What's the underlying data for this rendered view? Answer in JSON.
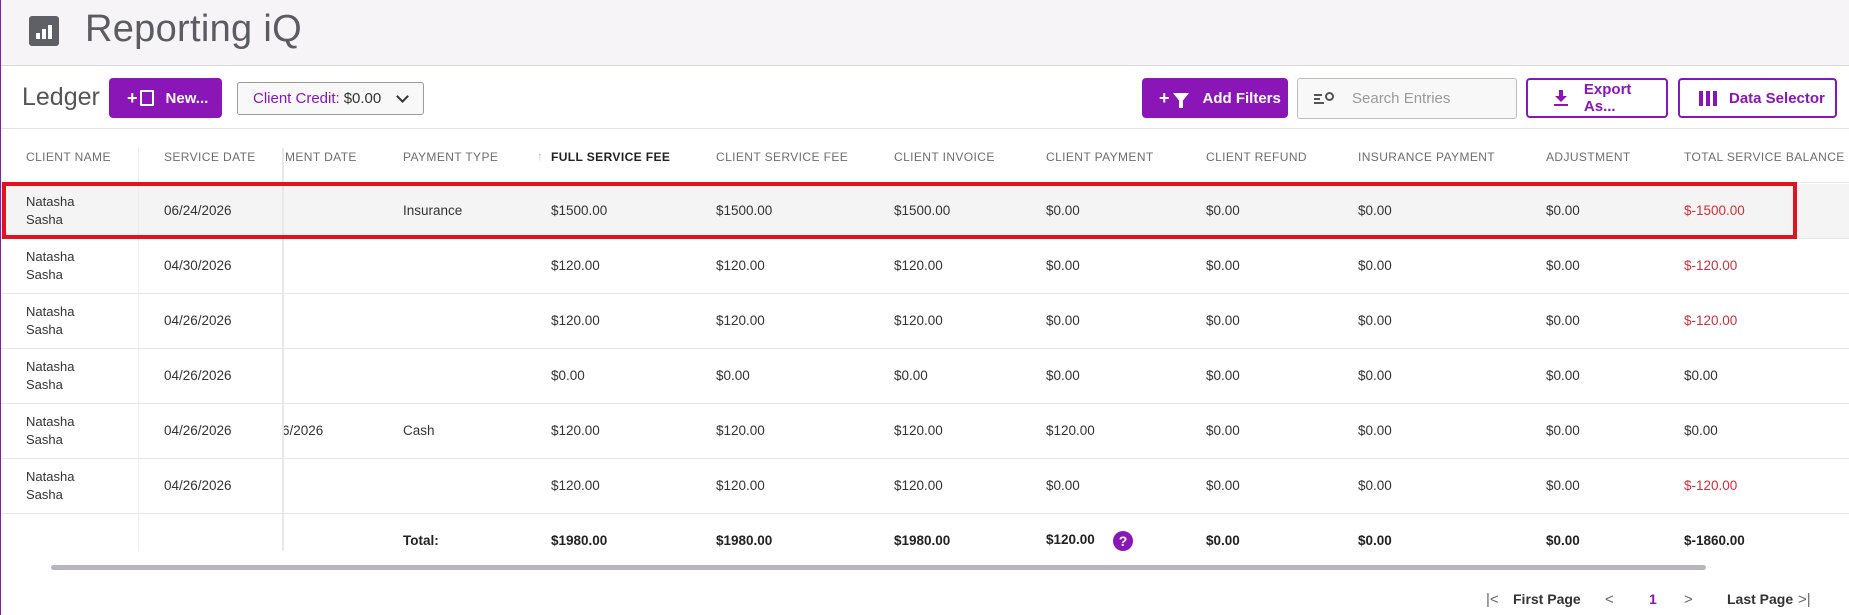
{
  "app": {
    "title": "Reporting iQ",
    "icon": "bar-chart-icon"
  },
  "toolbar": {
    "title": "Ledger",
    "new_label": "New...",
    "new_plus": "+",
    "credit_label": "Client Credit:",
    "credit_value": "$0.00",
    "filters_label": "Add Filters",
    "filters_plus": "+",
    "search_placeholder": "Search Entries",
    "export_label": "Export As...",
    "selector_label": "Data Selector"
  },
  "table": {
    "headers": {
      "client_name": "CLIENT NAME",
      "service_date": "SERVICE DATE",
      "payment_date": "MENT DATE",
      "payment_type": "PAYMENT TYPE",
      "full_service_fee": "FULL SERVICE FEE",
      "client_service_fee": "CLIENT SERVICE FEE",
      "client_invoice": "CLIENT INVOICE",
      "client_payment": "CLIENT PAYMENT",
      "client_refund": "CLIENT REFUND",
      "insurance_payment": "INSURANCE PAYMENT",
      "adjustment": "ADJUSTMENT",
      "total_service_balance": "TOTAL SERVICE BALANCE"
    },
    "sort_arrow": "↑",
    "rows": [
      {
        "name1": "Natasha",
        "name2": "Sasha",
        "service_date": "06/24/2026",
        "payment_date": "",
        "payment_type": "Insurance",
        "full_fee": "$1500.00",
        "client_fee": "$1500.00",
        "invoice": "$1500.00",
        "payment": "$0.00",
        "refund": "$0.00",
        "insurance": "$0.00",
        "adjustment": "$0.00",
        "balance": "$-1500.00"
      },
      {
        "name1": "Natasha",
        "name2": "Sasha",
        "service_date": "04/30/2026",
        "payment_date": "",
        "payment_type": "",
        "full_fee": "$120.00",
        "client_fee": "$120.00",
        "invoice": "$120.00",
        "payment": "$0.00",
        "refund": "$0.00",
        "insurance": "$0.00",
        "adjustment": "$0.00",
        "balance": "$-120.00"
      },
      {
        "name1": "Natasha",
        "name2": "Sasha",
        "service_date": "04/26/2026",
        "payment_date": "",
        "payment_type": "",
        "full_fee": "$120.00",
        "client_fee": "$120.00",
        "invoice": "$120.00",
        "payment": "$0.00",
        "refund": "$0.00",
        "insurance": "$0.00",
        "adjustment": "$0.00",
        "balance": "$-120.00"
      },
      {
        "name1": "Natasha",
        "name2": "Sasha",
        "service_date": "04/26/2026",
        "payment_date": "",
        "payment_type": "",
        "full_fee": "$0.00",
        "client_fee": "$0.00",
        "invoice": "$0.00",
        "payment": "$0.00",
        "refund": "$0.00",
        "insurance": "$0.00",
        "adjustment": "$0.00",
        "balance": "$0.00"
      },
      {
        "name1": "Natasha",
        "name2": "Sasha",
        "service_date": "04/26/2026",
        "payment_date": "6/2026",
        "payment_type": "Cash",
        "full_fee": "$120.00",
        "client_fee": "$120.00",
        "invoice": "$120.00",
        "payment": "$120.00",
        "refund": "$0.00",
        "insurance": "$0.00",
        "adjustment": "$0.00",
        "balance": "$0.00"
      },
      {
        "name1": "Natasha",
        "name2": "Sasha",
        "service_date": "04/26/2026",
        "payment_date": "",
        "payment_type": "",
        "full_fee": "$120.00",
        "client_fee": "$120.00",
        "invoice": "$120.00",
        "payment": "$0.00",
        "refund": "$0.00",
        "insurance": "$0.00",
        "adjustment": "$0.00",
        "balance": "$-120.00"
      }
    ],
    "total": {
      "label": "Total:",
      "full_fee": "$1980.00",
      "client_fee": "$1980.00",
      "invoice": "$1980.00",
      "payment": "$120.00",
      "help": "?",
      "refund": "$0.00",
      "insurance": "$0.00",
      "adjustment": "$0.00",
      "balance": "$-1860.00"
    }
  },
  "pagination": {
    "first_icon": "|<",
    "first_label": "First Page",
    "prev_icon": "<",
    "page": "1",
    "next_icon": ">",
    "last_label": "Last Page",
    "last_icon": ">|"
  },
  "colors": {
    "accent": "#8a16b8",
    "negative": "#d0303a",
    "highlight": "#e2131e"
  }
}
